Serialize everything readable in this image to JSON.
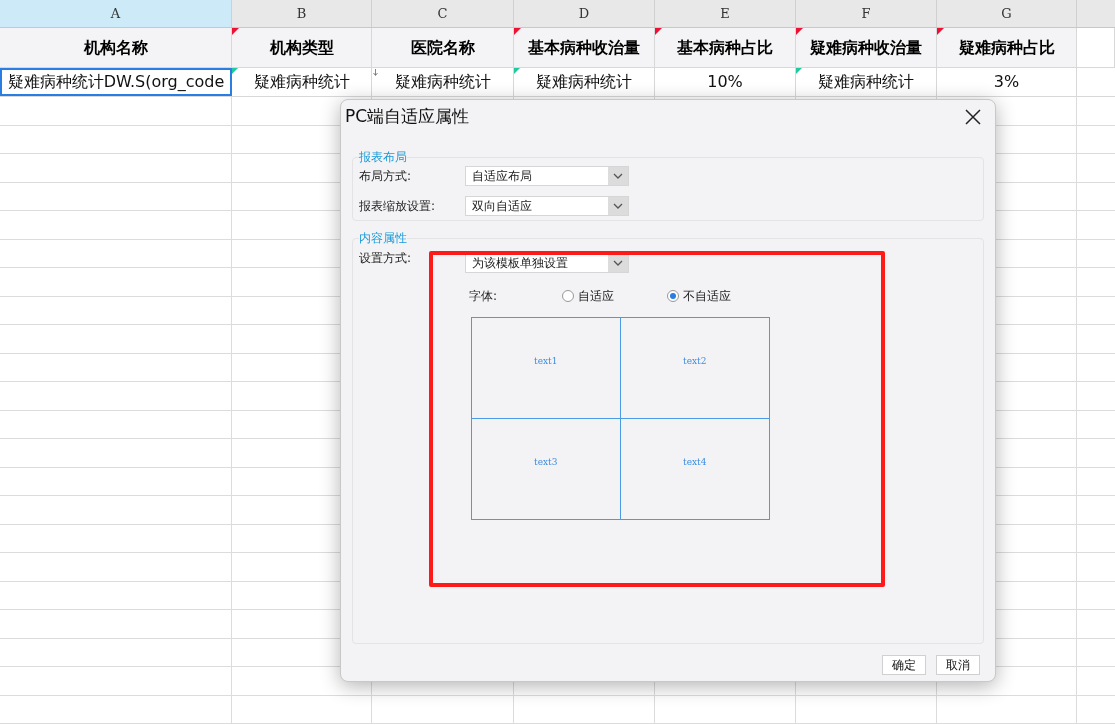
{
  "sheet": {
    "columns": [
      {
        "letter": "A",
        "selected": true,
        "header": "机构名称",
        "flagged": false,
        "cell": "疑难病种统计DW.S(org_code",
        "cell_selected": true,
        "kind": "plain"
      },
      {
        "letter": "B",
        "selected": false,
        "header": "机构类型",
        "flagged": true,
        "cell": "疑难病种统计",
        "cell_selected": false,
        "kind": "note"
      },
      {
        "letter": "C",
        "selected": false,
        "header": "医院名称",
        "flagged": false,
        "cell": "疑难病种统计",
        "cell_selected": false,
        "kind": "arrow"
      },
      {
        "letter": "D",
        "selected": false,
        "header": "基本病种收治量",
        "flagged": true,
        "cell": "疑难病种统计",
        "cell_selected": false,
        "kind": "note"
      },
      {
        "letter": "E",
        "selected": false,
        "header": "基本病种占比",
        "flagged": true,
        "cell": "10%",
        "cell_selected": false,
        "kind": "plain"
      },
      {
        "letter": "F",
        "selected": false,
        "header": "疑难病种收治量",
        "flagged": true,
        "cell": "疑难病种统计",
        "cell_selected": false,
        "kind": "note"
      },
      {
        "letter": "G",
        "selected": false,
        "header": "疑难病种占比",
        "flagged": true,
        "cell": "3%",
        "cell_selected": false,
        "kind": "plain"
      }
    ]
  },
  "dialog": {
    "title": "PC端自适应属性",
    "layout_group": {
      "legend": "报表布局",
      "rows": [
        {
          "label": "布局方式:",
          "value": "自适应布局"
        },
        {
          "label": "报表缩放设置:",
          "value": "双向自适应"
        }
      ]
    },
    "content_group": {
      "legend": "内容属性",
      "mode_label": "设置方式:",
      "mode_value": "为该模板单独设置",
      "font_label": "字体:",
      "font_options": [
        {
          "label": "自适应",
          "selected": false
        },
        {
          "label": "不自适应",
          "selected": true
        }
      ],
      "preview_cells": [
        "text1",
        "text2",
        "text3",
        "text4"
      ]
    },
    "highlight": true,
    "buttons": [
      "确定",
      "取消"
    ]
  }
}
